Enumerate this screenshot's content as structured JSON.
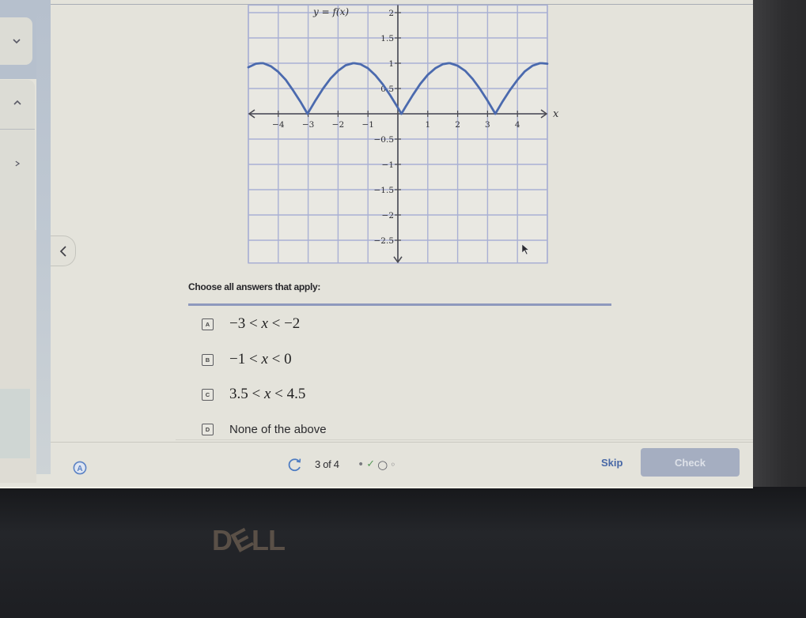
{
  "sidebar": {
    "buttons": [
      {
        "icon": "chevron-down-icon"
      },
      {
        "icon": "chevron-up-icon"
      },
      {
        "icon": "chevron-right-icon"
      }
    ],
    "collapse_button": {
      "icon": "chevron-left-icon"
    }
  },
  "question": {
    "prompt": "Choose all answers that apply:",
    "options": [
      {
        "letter": "A",
        "left": "−3 <",
        "var": "x",
        "right": "< −2"
      },
      {
        "letter": "B",
        "left": "−1 <",
        "var": "x",
        "right": "< 0"
      },
      {
        "letter": "C",
        "left": "3.5 <",
        "var": "x",
        "right": "< 4.5"
      },
      {
        "letter": "D",
        "text": "None of the above"
      }
    ]
  },
  "footer": {
    "accessibility_icon": "circled-a-icon",
    "accessibility_letter": "A",
    "refresh_icon": "refresh-icon",
    "progress_text": "3 of 4",
    "steps": [
      {
        "status": "attempted",
        "glyph": "•"
      },
      {
        "status": "correct",
        "glyph": "✓"
      },
      {
        "status": "current",
        "glyph": "○"
      },
      {
        "status": "upcoming",
        "glyph": "◦"
      }
    ],
    "skip_label": "Skip",
    "check_label": "Check"
  },
  "bezel": {
    "logo": [
      "D",
      "E",
      "LL"
    ]
  },
  "cursor_icon": "mouse-pointer-icon",
  "colors": {
    "accent": "#4767a6",
    "curve": "#4b6aae",
    "gridline": "#a9b0d4",
    "axis": "#4a4a52",
    "check_button": "#a5aec1",
    "correct": "#5a9a5a",
    "screen_background": "#e4e3db",
    "bezel": "#232428"
  },
  "chart_data": {
    "type": "line",
    "title": "y = f(x)",
    "xlabel": "x",
    "ylabel": "",
    "xlim": [
      -5,
      5
    ],
    "ylim": [
      -2.95,
      2.15
    ],
    "grid": true,
    "grid_step": {
      "x": 1,
      "y": 0.5
    },
    "legend": "none",
    "x_ticks": [
      -4,
      -3,
      -2,
      -1,
      1,
      2,
      3,
      4
    ],
    "x_tick_labels": [
      "−4",
      "−3",
      "−2",
      "−1",
      "1",
      "2",
      "3",
      "4"
    ],
    "y_ticks": [
      2,
      1.5,
      1,
      0.5,
      -0.5,
      -1,
      -1.5,
      -2,
      -2.5
    ],
    "y_tick_labels": [
      "2",
      "1.5",
      "1",
      "0.5",
      "−0.5",
      "−1",
      "−1.5",
      "−2",
      "−2.5"
    ],
    "series": [
      {
        "name": "f(x)",
        "points": [
          [
            -5,
            0.92
          ],
          [
            -4.75,
            0.99
          ],
          [
            -4.59,
            1
          ],
          [
            -4.5,
            1.0
          ],
          [
            -4.25,
            0.94
          ],
          [
            -4,
            0.83
          ],
          [
            -3.75,
            0.67
          ],
          [
            -3.5,
            0.46
          ],
          [
            -3.25,
            0.23
          ],
          [
            -3.02,
            0
          ],
          [
            -3,
            0.02
          ],
          [
            -2.75,
            0.27
          ],
          [
            -2.5,
            0.5
          ],
          [
            -2.25,
            0.7
          ],
          [
            -2,
            0.85
          ],
          [
            -1.75,
            0.96
          ],
          [
            -1.5,
            1.0
          ],
          [
            -1.45,
            1
          ],
          [
            -1.25,
            0.98
          ],
          [
            -1,
            0.9
          ],
          [
            -0.75,
            0.76
          ],
          [
            -0.5,
            0.58
          ],
          [
            -0.25,
            0.36
          ],
          [
            0,
            0.12
          ],
          [
            0.12,
            0
          ],
          [
            0.25,
            0.13
          ],
          [
            0.5,
            0.37
          ],
          [
            0.75,
            0.59
          ],
          [
            1,
            0.77
          ],
          [
            1.25,
            0.9
          ],
          [
            1.5,
            0.98
          ],
          [
            1.69,
            1
          ],
          [
            1.75,
            1.0
          ],
          [
            2,
            0.95
          ],
          [
            2.25,
            0.85
          ],
          [
            2.5,
            0.69
          ],
          [
            2.75,
            0.49
          ],
          [
            3,
            0.26
          ],
          [
            3.25,
            0.01
          ],
          [
            3.26,
            0
          ],
          [
            3.5,
            0.24
          ],
          [
            3.75,
            0.47
          ],
          [
            4,
            0.67
          ],
          [
            4.25,
            0.84
          ],
          [
            4.5,
            0.95
          ],
          [
            4.75,
            1.0
          ],
          [
            4.83,
            1
          ],
          [
            5,
            0.99
          ]
        ]
      }
    ],
    "annotations": {
      "zeros": [
        -3.02,
        0.12,
        3.26
      ],
      "maxima_x": [
        -4.59,
        -1.45,
        1.69,
        4.83
      ],
      "max_value": 1
    }
  }
}
